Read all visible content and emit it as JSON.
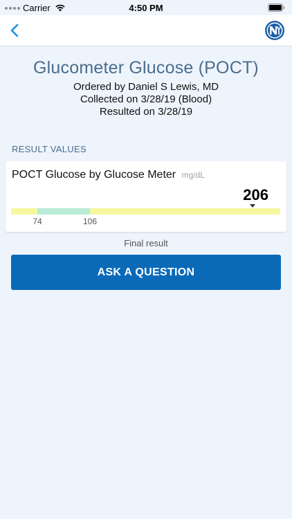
{
  "status_bar": {
    "carrier": "Carrier",
    "time": "4:50 PM"
  },
  "nav": {
    "back_icon": "chevron-left-icon",
    "logo": "ny-logo",
    "accent_color": "#1a8fe3"
  },
  "header": {
    "title": "Glucometer Glucose (POCT)",
    "ordered_by": "Ordered by Daniel S Lewis, MD",
    "collected": "Collected on 3/28/19 (Blood)",
    "resulted": "Resulted on 3/28/19"
  },
  "results": {
    "section_label": "RESULT VALUES",
    "items": [
      {
        "name": "POCT Glucose by Glucose Meter",
        "unit": "mg/dL",
        "value": "206",
        "range_low": "74",
        "range_high": "106",
        "colors": {
          "out_of_range": "#f6f79e",
          "normal_range": "#b8ecd6"
        }
      }
    ]
  },
  "status": {
    "final": "Final result"
  },
  "actions": {
    "ask_label": "ASK A QUESTION",
    "ask_color": "#0a6ab8"
  }
}
